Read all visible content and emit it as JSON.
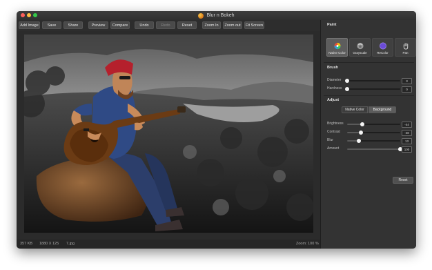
{
  "window": {
    "title": "Blur n Bokeh"
  },
  "toolbar": {
    "buttons": [
      {
        "label": "Add Image"
      },
      {
        "label": "Save"
      },
      {
        "label": "Share"
      },
      {
        "label": "Preview"
      },
      {
        "label": "Compare"
      },
      {
        "label": "Undo"
      },
      {
        "label": "Redo"
      },
      {
        "label": "Reset"
      },
      {
        "label": "Zoom In"
      },
      {
        "label": "Zoom out"
      },
      {
        "label": "Fit Screen"
      }
    ]
  },
  "status": {
    "file_size": "357 KB",
    "dimensions": "1880 X 125",
    "file_name": "7.jpg",
    "zoom": "Zoom: 100 %"
  },
  "panel": {
    "paint": {
      "title": "Paint",
      "tools": [
        {
          "label": "Native Color",
          "icon": "color-wheel-icon",
          "active": true
        },
        {
          "label": "Grayscale",
          "icon": "grayscale-ball-icon",
          "active": false
        },
        {
          "label": "ReColor",
          "icon": "recolor-circle-icon",
          "active": false
        },
        {
          "label": "Pan",
          "icon": "hand-icon",
          "active": false
        }
      ]
    },
    "brush": {
      "title": "Brush",
      "sliders": [
        {
          "label": "Diameter",
          "value": "3",
          "level": 0
        },
        {
          "label": "Hardness",
          "value": "0",
          "level": 0
        }
      ]
    },
    "adjust": {
      "title": "Adjust",
      "modes": [
        {
          "label": "Native Color",
          "active": false
        },
        {
          "label": "Background",
          "active": true
        }
      ],
      "sliders": [
        {
          "label": "Brightness",
          "value": "-44",
          "level": 0.28
        },
        {
          "label": "Contrast",
          "value": "-48",
          "level": 0.26
        },
        {
          "label": "Blur",
          "value": "13",
          "level": 0.22
        },
        {
          "label": "Amount",
          "value": "100",
          "level": 1.0
        }
      ],
      "reset_label": "Reset"
    }
  },
  "colors": {
    "accent_recolor": "#6b4bd8",
    "window_bg": "#2a2a2a",
    "panel_bg": "#333333"
  }
}
